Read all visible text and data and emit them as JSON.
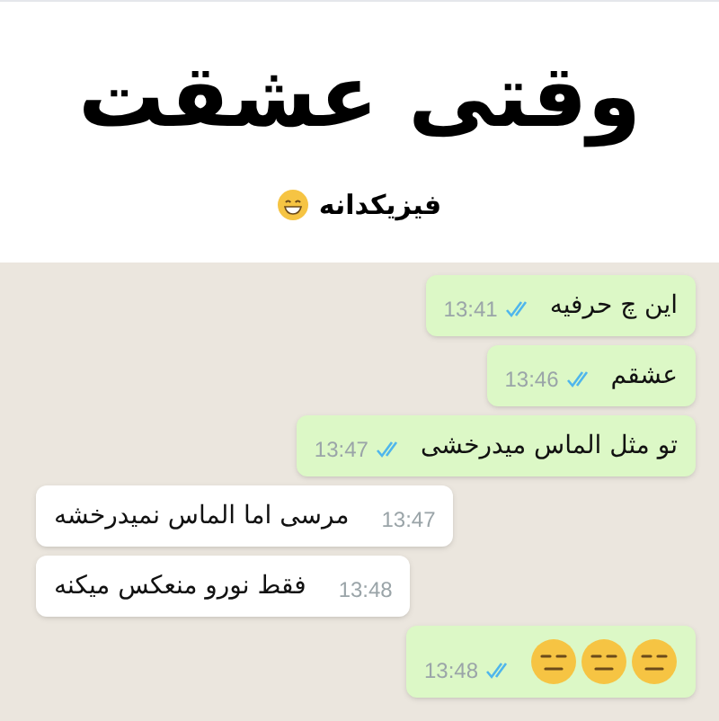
{
  "header": {
    "title": "وقتی عشقت",
    "subtitle": "فیزیکدانه"
  },
  "messages": [
    {
      "kind": "text",
      "outgoing": true,
      "text": "این چ حرفیه",
      "time": "13:41",
      "read": true
    },
    {
      "kind": "text",
      "outgoing": true,
      "text": "عشقم",
      "time": "13:46",
      "read": true
    },
    {
      "kind": "text",
      "outgoing": true,
      "text": "تو مثل الماس میدرخشی",
      "time": "13:47",
      "read": true
    },
    {
      "kind": "text",
      "outgoing": false,
      "text": "مرسی اما الماس نمیدرخشه",
      "time": "13:47"
    },
    {
      "kind": "text",
      "outgoing": false,
      "text": "فقط نورو منعکس میکنه",
      "time": "13:48"
    },
    {
      "kind": "emoji",
      "outgoing": true,
      "time": "13:48",
      "read": true
    }
  ]
}
